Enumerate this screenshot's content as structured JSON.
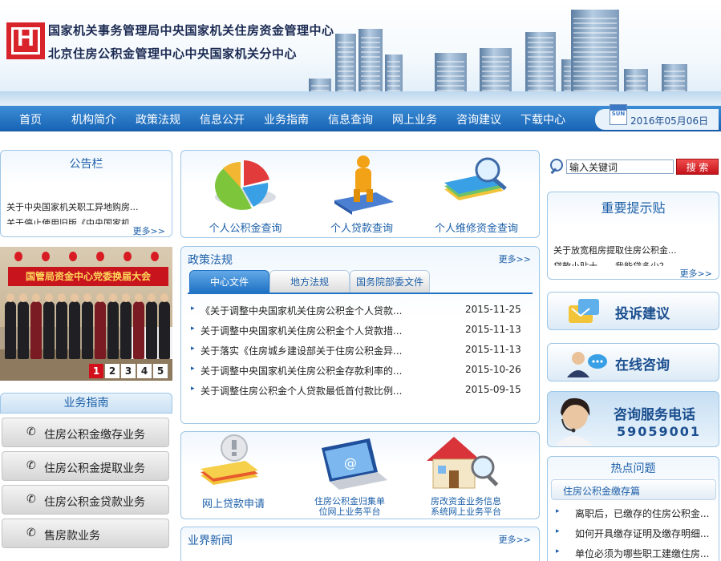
{
  "header": {
    "org_line1": "国家机关事务管理局中央国家机关住房资金管理中心",
    "org_line2": "北京住房公积金管理中心中央国家机关分中心"
  },
  "nav": {
    "items": [
      "首页",
      "机构简介",
      "政策法规",
      "信息公开",
      "业务指南",
      "信息查询",
      "网上业务",
      "咨询建议",
      "下载中心"
    ],
    "date": "2016年05月06日",
    "calendar_icon_label": "SUN"
  },
  "notice": {
    "title": "公告栏",
    "items": [
      "关于中央国家机关职工异地购房...",
      "关于停止使用旧版《中央国家机"
    ],
    "more": "更多>>"
  },
  "photo": {
    "banner": "国管局资金中心党委换届大会",
    "slides": [
      "1",
      "2",
      "3",
      "4",
      "5"
    ],
    "active_slide": "1"
  },
  "guide": {
    "title": "业务指南",
    "items": [
      "住房公积金缴存业务",
      "住房公积金提取业务",
      "住房公积金贷款业务",
      "售房款业务"
    ]
  },
  "query": {
    "items": [
      "个人公积金查询",
      "个人贷款查询",
      "个人维修资金查询"
    ]
  },
  "policy": {
    "title": "政策法规",
    "more": "更多>>",
    "tabs": [
      "中心文件",
      "地方法规",
      "国务院部委文件"
    ],
    "active_tab": "中心文件",
    "rows": [
      {
        "title": "《关于调整中央国家机关住房公积金个人贷款...",
        "date": "2015-11-25"
      },
      {
        "title": "关于调整中央国家机关住房公积金个人贷款措...",
        "date": "2015-11-13"
      },
      {
        "title": "关于落实《住房城乡建设部关于住房公积金异...",
        "date": "2015-11-13"
      },
      {
        "title": "关于调整中央国家机关住房公积金存款利率的...",
        "date": "2015-10-26"
      },
      {
        "title": "关于调整住房公积金个人贷款最低首付款比例...",
        "date": "2015-09-15"
      }
    ]
  },
  "online": {
    "items": [
      {
        "line1": "网上贷款申请",
        "line2": ""
      },
      {
        "line1": "住房公积金归集单",
        "line2": "位网上业务平台"
      },
      {
        "line1": "房改资金业务信息",
        "line2": "系统网上业务平台"
      }
    ]
  },
  "news": {
    "title": "业界新闻",
    "more": "更多>>"
  },
  "search": {
    "placeholder": "输入关键词",
    "button": "搜 索"
  },
  "tips": {
    "title": "重要提示贴",
    "items": [
      "关于放宽租房提取住房公积金...",
      "贷款小贴士——我能贷多少？"
    ],
    "more": "更多>>"
  },
  "complaint": {
    "label": "投诉建议"
  },
  "consult": {
    "label": "在线咨询"
  },
  "hotline": {
    "label": "咨询服务电话",
    "number": "59059001"
  },
  "hot": {
    "title": "热点问题",
    "subtitle": "住房公积金缴存篇",
    "items": [
      "离职后，已缴存的住房公积金...",
      "如何开具缴存证明及缴存明细...",
      "单位必须为哪些职工建缴住房..."
    ]
  },
  "colors": {
    "nav_blue": "#1764b5",
    "link_blue": "#1c5fa8",
    "search_red": "#c4121a",
    "border_blue": "#9ec6e6"
  }
}
